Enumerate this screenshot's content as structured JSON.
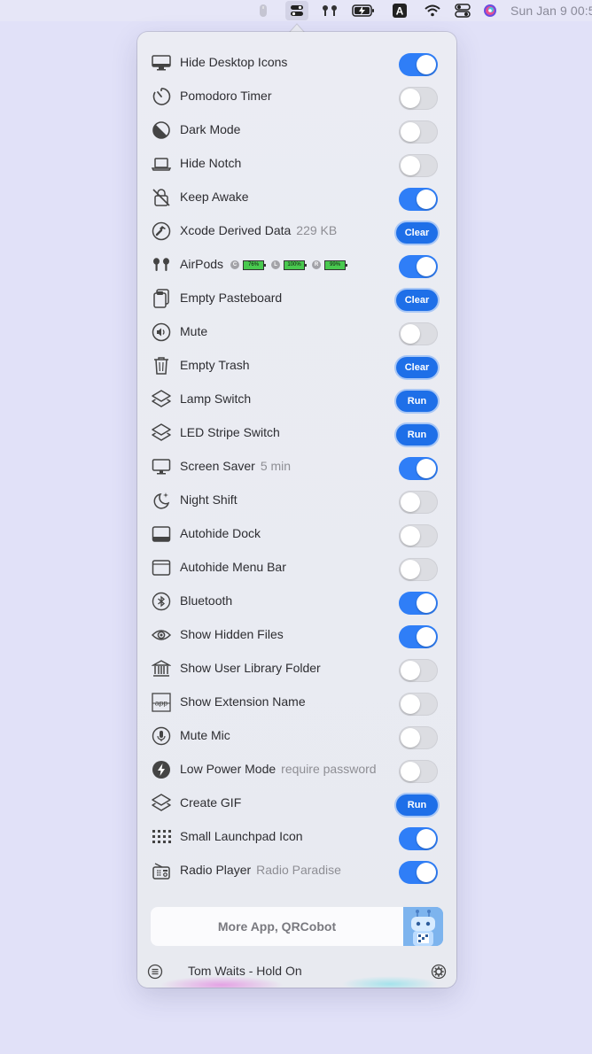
{
  "menubar": {
    "clock": "Sun Jan 9  00:5"
  },
  "items": [
    {
      "label": "Hide Desktop Icons",
      "meta": "",
      "icon": "desktop-icon",
      "control": "toggle",
      "on": true
    },
    {
      "label": "Pomodoro Timer",
      "meta": "",
      "icon": "timer-icon",
      "control": "toggle",
      "on": false
    },
    {
      "label": "Dark Mode",
      "meta": "",
      "icon": "dark-mode-icon",
      "control": "toggle",
      "on": false
    },
    {
      "label": "Hide Notch",
      "meta": "",
      "icon": "laptop-icon",
      "control": "toggle",
      "on": false
    },
    {
      "label": "Keep Awake",
      "meta": "",
      "icon": "keep-awake-icon",
      "control": "toggle",
      "on": true
    },
    {
      "label": "Xcode Derived Data",
      "meta": "229 KB",
      "icon": "hammer-icon",
      "control": "button",
      "button_label": "Clear"
    },
    {
      "label": "AirPods",
      "meta": "",
      "icon": "airpods-icon",
      "control": "toggle",
      "on": true,
      "batteries": [
        {
          "ch": "C",
          "level": "76%"
        },
        {
          "ch": "L",
          "level": "100%"
        },
        {
          "ch": "R",
          "level": "99%"
        }
      ]
    },
    {
      "label": "Empty Pasteboard",
      "meta": "",
      "icon": "clipboard-icon",
      "control": "button",
      "button_label": "Clear"
    },
    {
      "label": "Mute",
      "meta": "",
      "icon": "speaker-icon",
      "control": "toggle",
      "on": false
    },
    {
      "label": "Empty Trash",
      "meta": "",
      "icon": "trash-icon",
      "control": "button",
      "button_label": "Clear"
    },
    {
      "label": "Lamp Switch",
      "meta": "",
      "icon": "shortcuts-icon",
      "control": "button",
      "button_label": "Run"
    },
    {
      "label": "LED Stripe Switch",
      "meta": "",
      "icon": "shortcuts-icon",
      "control": "button",
      "button_label": "Run"
    },
    {
      "label": "Screen Saver",
      "meta": "5 min",
      "icon": "monitor-icon",
      "control": "toggle",
      "on": true
    },
    {
      "label": "Night Shift",
      "meta": "",
      "icon": "moon-icon",
      "control": "toggle",
      "on": false
    },
    {
      "label": "Autohide Dock",
      "meta": "",
      "icon": "dock-icon",
      "control": "toggle",
      "on": false
    },
    {
      "label": "Autohide Menu Bar",
      "meta": "",
      "icon": "menubar-icon",
      "control": "toggle",
      "on": false
    },
    {
      "label": "Bluetooth",
      "meta": "",
      "icon": "bluetooth-icon",
      "control": "toggle",
      "on": true
    },
    {
      "label": "Show Hidden Files",
      "meta": "",
      "icon": "eye-icon",
      "control": "toggle",
      "on": true
    },
    {
      "label": "Show User Library Folder",
      "meta": "",
      "icon": "library-icon",
      "control": "toggle",
      "on": false
    },
    {
      "label": "Show Extension Name",
      "meta": "",
      "icon": "extension-icon",
      "icon_text": "app",
      "control": "toggle",
      "on": false
    },
    {
      "label": "Mute Mic",
      "meta": "",
      "icon": "microphone-icon",
      "control": "toggle",
      "on": false
    },
    {
      "label": "Low Power Mode",
      "meta": "require password",
      "icon": "bolt-icon",
      "control": "toggle",
      "on": false
    },
    {
      "label": "Create GIF",
      "meta": "",
      "icon": "shortcuts-icon",
      "control": "button",
      "button_label": "Run"
    },
    {
      "label": "Small Launchpad Icon",
      "meta": "",
      "icon": "grid-icon",
      "control": "toggle",
      "on": true
    },
    {
      "label": "Radio Player",
      "meta": "Radio Paradise",
      "icon": "radio-icon",
      "control": "toggle",
      "on": true
    }
  ],
  "footer": {
    "more_app_label": "More App, QRCobot",
    "now_playing": "Tom Waits - Hold On"
  },
  "colors": {
    "accent": "#2f7ef7",
    "button": "#1e6fe8",
    "battery_green": "#49c94f"
  }
}
